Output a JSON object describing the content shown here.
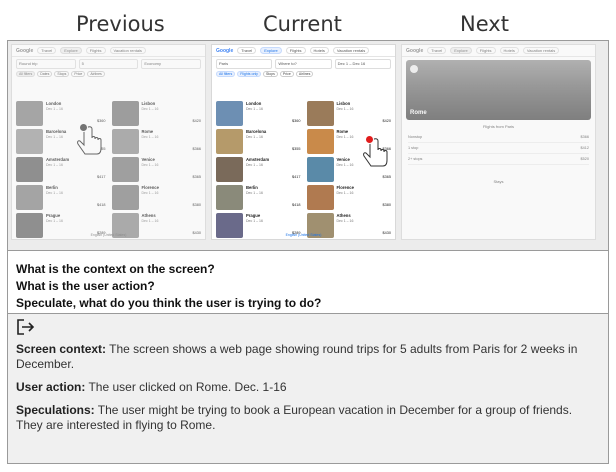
{
  "headers": {
    "previous": "Previous",
    "current": "Current",
    "next": "Next"
  },
  "screens": {
    "previous": {
      "topbar": {
        "logo": "Google",
        "tabs": [
          "Travel",
          "Explore",
          "Flights",
          "Vacation rentals"
        ]
      },
      "fields": [
        "Round trip",
        "5",
        "Economy"
      ],
      "chips": [
        "All filters",
        "Dates",
        "Stops",
        "Price",
        "Airlines",
        "Duration",
        "Bags"
      ],
      "cards": [
        {
          "name": "London",
          "sub": "Dec 1 – 16",
          "price": "$360"
        },
        {
          "name": "Lisbon",
          "sub": "Dec 1 – 16",
          "price": "$420"
        },
        {
          "name": "Barcelona",
          "sub": "Dec 1 – 16",
          "price": "$355"
        },
        {
          "name": "Rome",
          "sub": "Dec 1 – 16",
          "price": "$366"
        },
        {
          "name": "Amsterdam",
          "sub": "Dec 1 – 16",
          "price": "$417"
        },
        {
          "name": "Venice",
          "sub": "Dec 1 – 16",
          "price": "$365"
        },
        {
          "name": "Berlin",
          "sub": "Dec 1 – 16",
          "price": "$418"
        },
        {
          "name": "Florence",
          "sub": "Dec 1 – 16",
          "price": "$380"
        },
        {
          "name": "Prague",
          "sub": "Dec 1 – 16",
          "price": "$289"
        },
        {
          "name": "Athens",
          "sub": "Dec 1 – 16",
          "price": "$430"
        }
      ],
      "footer": "English (United States)"
    },
    "current": {
      "topbar": {
        "logo": "Google",
        "tabs": [
          "Travel",
          "Explore",
          "Flights",
          "Hotels",
          "Vacation rentals"
        ]
      },
      "fields": [
        "Paris",
        "Where to?",
        "Dec 1 – Dec 16"
      ],
      "chips": [
        "All filters",
        "Flights only",
        "Stops",
        "Price",
        "Airlines",
        "Duration",
        "Bags"
      ],
      "cards": [
        {
          "name": "London",
          "sub": "Dec 1 – 16",
          "price": "$360"
        },
        {
          "name": "Lisbon",
          "sub": "Dec 1 – 16",
          "price": "$420"
        },
        {
          "name": "Barcelona",
          "sub": "Dec 1 – 16",
          "price": "$355"
        },
        {
          "name": "Rome",
          "sub": "Dec 1 – 16",
          "price": "$366"
        },
        {
          "name": "Amsterdam",
          "sub": "Dec 1 – 16",
          "price": "$417"
        },
        {
          "name": "Venice",
          "sub": "Dec 1 – 16",
          "price": "$365"
        },
        {
          "name": "Berlin",
          "sub": "Dec 1 – 16",
          "price": "$418"
        },
        {
          "name": "Florence",
          "sub": "Dec 1 – 16",
          "price": "$380"
        },
        {
          "name": "Prague",
          "sub": "Dec 1 – 16",
          "price": "$289"
        },
        {
          "name": "Athens",
          "sub": "Dec 1 – 16",
          "price": "$430"
        }
      ],
      "footer": "English (United States)"
    },
    "next": {
      "topbar": {
        "logo": "Google",
        "tabs": [
          "Travel",
          "Explore",
          "Flights",
          "Hotels",
          "Vacation rentals"
        ]
      },
      "hero_title": "Rome",
      "panel_label": "Flights from Paris",
      "rows": [
        {
          "label": "Nonstop",
          "value": "$366"
        },
        {
          "label": "1 stop",
          "value": "$412"
        },
        {
          "label": "2+ stops",
          "value": "$520"
        }
      ],
      "section_label": "Stays"
    }
  },
  "questions": [
    "What is the context on the screen?",
    "What is the user action?",
    "Speculate, what do you think the user is trying to do?"
  ],
  "answers": {
    "context_label": "Screen context:",
    "context_text": " The screen shows a web page showing round trips for 5 adults from Paris for 2 weeks in December.",
    "action_label": "User action:",
    "action_text": " The user clicked on Rome. Dec. 1-16",
    "speculation_label": "Speculations:",
    "speculation_text": " The user might be trying to book a European vacation in December for a group of friends. They are interested in flying to Rome."
  },
  "icons": {
    "answer": "export-arrow-icon",
    "click": "hand-pointer-icon"
  },
  "colors": {
    "brand_blue": "#1a73e8",
    "click_dot": "#e01c1c"
  }
}
